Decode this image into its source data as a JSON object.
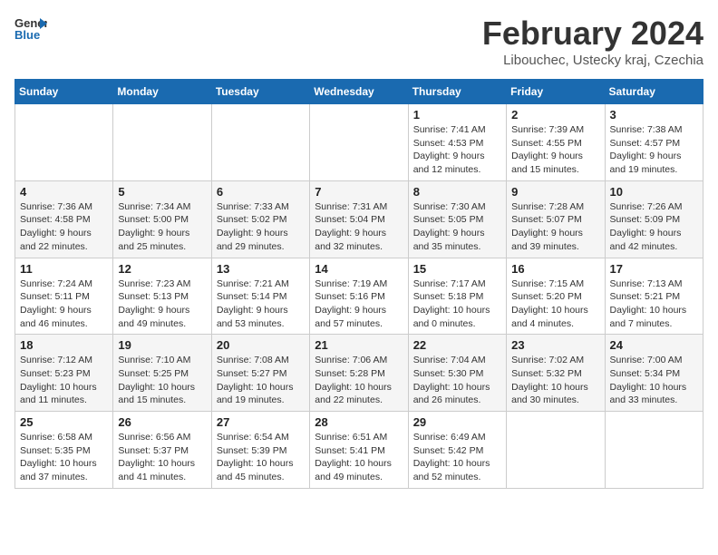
{
  "header": {
    "logo_line1": "General",
    "logo_line2": "Blue",
    "month_title": "February 2024",
    "location": "Libouchec, Ustecky kraj, Czechia"
  },
  "days_of_week": [
    "Sunday",
    "Monday",
    "Tuesday",
    "Wednesday",
    "Thursday",
    "Friday",
    "Saturday"
  ],
  "weeks": [
    [
      {
        "day": "",
        "info": ""
      },
      {
        "day": "",
        "info": ""
      },
      {
        "day": "",
        "info": ""
      },
      {
        "day": "",
        "info": ""
      },
      {
        "day": "1",
        "info": "Sunrise: 7:41 AM\nSunset: 4:53 PM\nDaylight: 9 hours\nand 12 minutes."
      },
      {
        "day": "2",
        "info": "Sunrise: 7:39 AM\nSunset: 4:55 PM\nDaylight: 9 hours\nand 15 minutes."
      },
      {
        "day": "3",
        "info": "Sunrise: 7:38 AM\nSunset: 4:57 PM\nDaylight: 9 hours\nand 19 minutes."
      }
    ],
    [
      {
        "day": "4",
        "info": "Sunrise: 7:36 AM\nSunset: 4:58 PM\nDaylight: 9 hours\nand 22 minutes."
      },
      {
        "day": "5",
        "info": "Sunrise: 7:34 AM\nSunset: 5:00 PM\nDaylight: 9 hours\nand 25 minutes."
      },
      {
        "day": "6",
        "info": "Sunrise: 7:33 AM\nSunset: 5:02 PM\nDaylight: 9 hours\nand 29 minutes."
      },
      {
        "day": "7",
        "info": "Sunrise: 7:31 AM\nSunset: 5:04 PM\nDaylight: 9 hours\nand 32 minutes."
      },
      {
        "day": "8",
        "info": "Sunrise: 7:30 AM\nSunset: 5:05 PM\nDaylight: 9 hours\nand 35 minutes."
      },
      {
        "day": "9",
        "info": "Sunrise: 7:28 AM\nSunset: 5:07 PM\nDaylight: 9 hours\nand 39 minutes."
      },
      {
        "day": "10",
        "info": "Sunrise: 7:26 AM\nSunset: 5:09 PM\nDaylight: 9 hours\nand 42 minutes."
      }
    ],
    [
      {
        "day": "11",
        "info": "Sunrise: 7:24 AM\nSunset: 5:11 PM\nDaylight: 9 hours\nand 46 minutes."
      },
      {
        "day": "12",
        "info": "Sunrise: 7:23 AM\nSunset: 5:13 PM\nDaylight: 9 hours\nand 49 minutes."
      },
      {
        "day": "13",
        "info": "Sunrise: 7:21 AM\nSunset: 5:14 PM\nDaylight: 9 hours\nand 53 minutes."
      },
      {
        "day": "14",
        "info": "Sunrise: 7:19 AM\nSunset: 5:16 PM\nDaylight: 9 hours\nand 57 minutes."
      },
      {
        "day": "15",
        "info": "Sunrise: 7:17 AM\nSunset: 5:18 PM\nDaylight: 10 hours\nand 0 minutes."
      },
      {
        "day": "16",
        "info": "Sunrise: 7:15 AM\nSunset: 5:20 PM\nDaylight: 10 hours\nand 4 minutes."
      },
      {
        "day": "17",
        "info": "Sunrise: 7:13 AM\nSunset: 5:21 PM\nDaylight: 10 hours\nand 7 minutes."
      }
    ],
    [
      {
        "day": "18",
        "info": "Sunrise: 7:12 AM\nSunset: 5:23 PM\nDaylight: 10 hours\nand 11 minutes."
      },
      {
        "day": "19",
        "info": "Sunrise: 7:10 AM\nSunset: 5:25 PM\nDaylight: 10 hours\nand 15 minutes."
      },
      {
        "day": "20",
        "info": "Sunrise: 7:08 AM\nSunset: 5:27 PM\nDaylight: 10 hours\nand 19 minutes."
      },
      {
        "day": "21",
        "info": "Sunrise: 7:06 AM\nSunset: 5:28 PM\nDaylight: 10 hours\nand 22 minutes."
      },
      {
        "day": "22",
        "info": "Sunrise: 7:04 AM\nSunset: 5:30 PM\nDaylight: 10 hours\nand 26 minutes."
      },
      {
        "day": "23",
        "info": "Sunrise: 7:02 AM\nSunset: 5:32 PM\nDaylight: 10 hours\nand 30 minutes."
      },
      {
        "day": "24",
        "info": "Sunrise: 7:00 AM\nSunset: 5:34 PM\nDaylight: 10 hours\nand 33 minutes."
      }
    ],
    [
      {
        "day": "25",
        "info": "Sunrise: 6:58 AM\nSunset: 5:35 PM\nDaylight: 10 hours\nand 37 minutes."
      },
      {
        "day": "26",
        "info": "Sunrise: 6:56 AM\nSunset: 5:37 PM\nDaylight: 10 hours\nand 41 minutes."
      },
      {
        "day": "27",
        "info": "Sunrise: 6:54 AM\nSunset: 5:39 PM\nDaylight: 10 hours\nand 45 minutes."
      },
      {
        "day": "28",
        "info": "Sunrise: 6:51 AM\nSunset: 5:41 PM\nDaylight: 10 hours\nand 49 minutes."
      },
      {
        "day": "29",
        "info": "Sunrise: 6:49 AM\nSunset: 5:42 PM\nDaylight: 10 hours\nand 52 minutes."
      },
      {
        "day": "",
        "info": ""
      },
      {
        "day": "",
        "info": ""
      }
    ]
  ]
}
